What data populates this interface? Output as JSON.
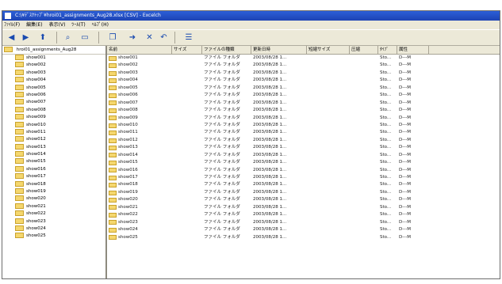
{
  "window": {
    "title": "C:\\¥ﾃﾞｽｸﾄｯﾌﾟ¥hroi01_assignments_Aug28.xlsx [CSV] - Excelch"
  },
  "menu": [
    "ﾌｧｲﾙ(F)",
    "編集(E)",
    "表示(V)",
    "ﾂｰﾙ(T)",
    "ﾍﾙﾌﾟ(H)"
  ],
  "toolbar_icons": [
    "back-icon",
    "forward-icon",
    "up-icon",
    "search-icon",
    "folders-icon",
    "copy-icon",
    "move-icon",
    "delete-icon",
    "undo-icon",
    "views-icon"
  ],
  "tree": {
    "root": "hroi01_assignments_Aug28",
    "items": [
      "show001",
      "show002",
      "show003",
      "show004",
      "show005",
      "show006",
      "show007",
      "show008",
      "show009",
      "show010",
      "show011",
      "show012",
      "show013",
      "show014",
      "show015",
      "show016",
      "show017",
      "show018",
      "show019",
      "show020",
      "show021",
      "show022",
      "show023",
      "show024",
      "show025"
    ]
  },
  "columns": [
    "名前",
    "サイズ",
    "ファイルの種類",
    "更新日時",
    "短縮サイズ",
    "圧縮",
    "ﾀｲﾌﾟ",
    "属性"
  ],
  "files": [
    [
      "show001",
      "",
      "ファイル フォルダ",
      "2003/08/28 1...",
      "",
      "",
      "Sto...",
      "D---M"
    ],
    [
      "show002",
      "",
      "ファイル フォルダ",
      "2003/08/28 1...",
      "",
      "",
      "Sto...",
      "D---M"
    ],
    [
      "show003",
      "",
      "ファイル フォルダ",
      "2003/08/28 1...",
      "",
      "",
      "Sto...",
      "D---M"
    ],
    [
      "show004",
      "",
      "ファイル フォルダ",
      "2003/08/28 1...",
      "",
      "",
      "Sto...",
      "D---M"
    ],
    [
      "show005",
      "",
      "ファイル フォルダ",
      "2003/08/28 1...",
      "",
      "",
      "Sto...",
      "D---M"
    ],
    [
      "show006",
      "",
      "ファイル フォルダ",
      "2003/08/28 1...",
      "",
      "",
      "Sto...",
      "D---M"
    ],
    [
      "show007",
      "",
      "ファイル フォルダ",
      "2003/08/28 1...",
      "",
      "",
      "Sto...",
      "D---M"
    ],
    [
      "show008",
      "",
      "ファイル フォルダ",
      "2003/08/28 1...",
      "",
      "",
      "Sto...",
      "D---M"
    ],
    [
      "show009",
      "",
      "ファイル フォルダ",
      "2003/08/28 1...",
      "",
      "",
      "Sto...",
      "D---M"
    ],
    [
      "show010",
      "",
      "ファイル フォルダ",
      "2003/08/28 1...",
      "",
      "",
      "Sto...",
      "D---M"
    ],
    [
      "show011",
      "",
      "ファイル フォルダ",
      "2003/08/28 1...",
      "",
      "",
      "Sto...",
      "D---M"
    ],
    [
      "show012",
      "",
      "ファイル フォルダ",
      "2003/08/28 1...",
      "",
      "",
      "Sto...",
      "D---M"
    ],
    [
      "show013",
      "",
      "ファイル フォルダ",
      "2003/08/28 1...",
      "",
      "",
      "Sto...",
      "D---M"
    ],
    [
      "show014",
      "",
      "ファイル フォルダ",
      "2003/08/28 1...",
      "",
      "",
      "Sto...",
      "D---M"
    ],
    [
      "show015",
      "",
      "ファイル フォルダ",
      "2003/08/28 1...",
      "",
      "",
      "Sto...",
      "D---M"
    ],
    [
      "show016",
      "",
      "ファイル フォルダ",
      "2003/08/28 1...",
      "",
      "",
      "Sto...",
      "D---M"
    ],
    [
      "show017",
      "",
      "ファイル フォルダ",
      "2003/08/28 1...",
      "",
      "",
      "Sto...",
      "D---M"
    ],
    [
      "show018",
      "",
      "ファイル フォルダ",
      "2003/08/28 1...",
      "",
      "",
      "Sto...",
      "D---M"
    ],
    [
      "show019",
      "",
      "ファイル フォルダ",
      "2003/08/28 1...",
      "",
      "",
      "Sto...",
      "D---M"
    ],
    [
      "show020",
      "",
      "ファイル フォルダ",
      "2003/08/28 1...",
      "",
      "",
      "Sto...",
      "D---M"
    ],
    [
      "show021",
      "",
      "ファイル フォルダ",
      "2003/08/28 1...",
      "",
      "",
      "Sto...",
      "D---M"
    ],
    [
      "show022",
      "",
      "ファイル フォルダ",
      "2003/08/28 1...",
      "",
      "",
      "Sto...",
      "D---M"
    ],
    [
      "show023",
      "",
      "ファイル フォルダ",
      "2003/08/28 1...",
      "",
      "",
      "Sto...",
      "D---M"
    ],
    [
      "show024",
      "",
      "ファイル フォルダ",
      "2003/08/28 1...",
      "",
      "",
      "Sto...",
      "D---M"
    ],
    [
      "show025",
      "",
      "ファイル フォルダ",
      "2003/08/28 1...",
      "",
      "",
      "Sto...",
      "D---M"
    ]
  ],
  "colors": {
    "titlebar": "#2c5fd8",
    "folder": "#f5d76e",
    "chrome": "#ece9d8"
  }
}
